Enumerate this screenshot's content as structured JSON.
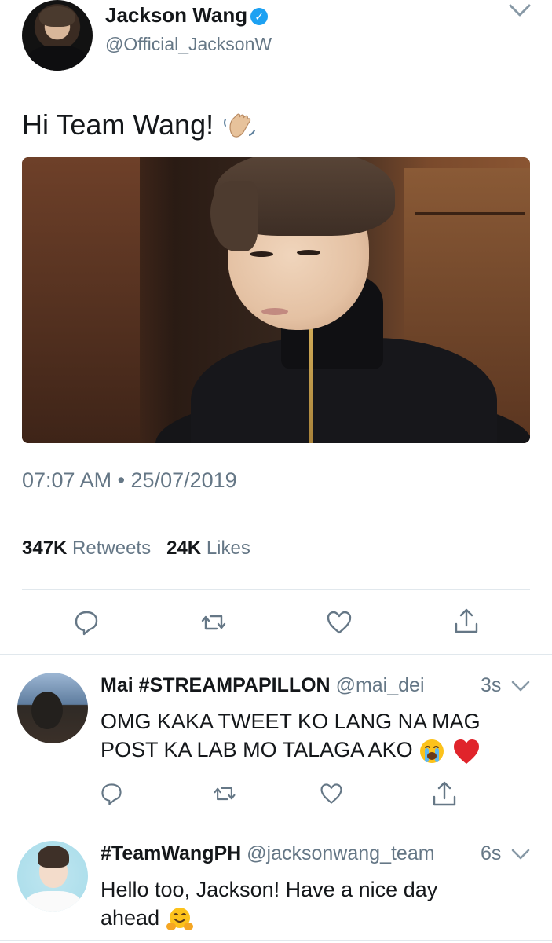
{
  "main_tweet": {
    "author_name": "Jackson Wang",
    "verified_icon": "verified-badge-icon",
    "author_handle": "@Official_JacksonW",
    "text": "Hi Team Wang!",
    "emoji": "waving-hand-icon",
    "timestamp": "07:07 AM • 25/07/2019",
    "retweets_count": "347K",
    "retweets_label": "Retweets",
    "likes_count": "24K",
    "likes_label": "Likes"
  },
  "replies": [
    {
      "author_name": "Mai #STREAMPAPILLON",
      "author_handle": "@mai_dei",
      "time": "3s",
      "text_line1": "OMG KAKA TWEET KO LANG NA MAG",
      "text_line2": "POST KA LAB MO TALAGA AKO",
      "emojis": [
        "loudly-crying-face-icon",
        "red-heart-icon"
      ]
    },
    {
      "author_name": "#TeamWangPH",
      "author_handle": "@jacksonwang_team",
      "time": "6s",
      "text_line1": "Hello too, Jackson! Have a nice day",
      "text_line2": "ahead",
      "emojis": [
        "hugging-face-icon"
      ]
    }
  ],
  "colors": {
    "text_primary": "#14171a",
    "text_secondary": "#657786",
    "divider": "#e1e8ed",
    "verified_blue": "#1da1f2"
  }
}
